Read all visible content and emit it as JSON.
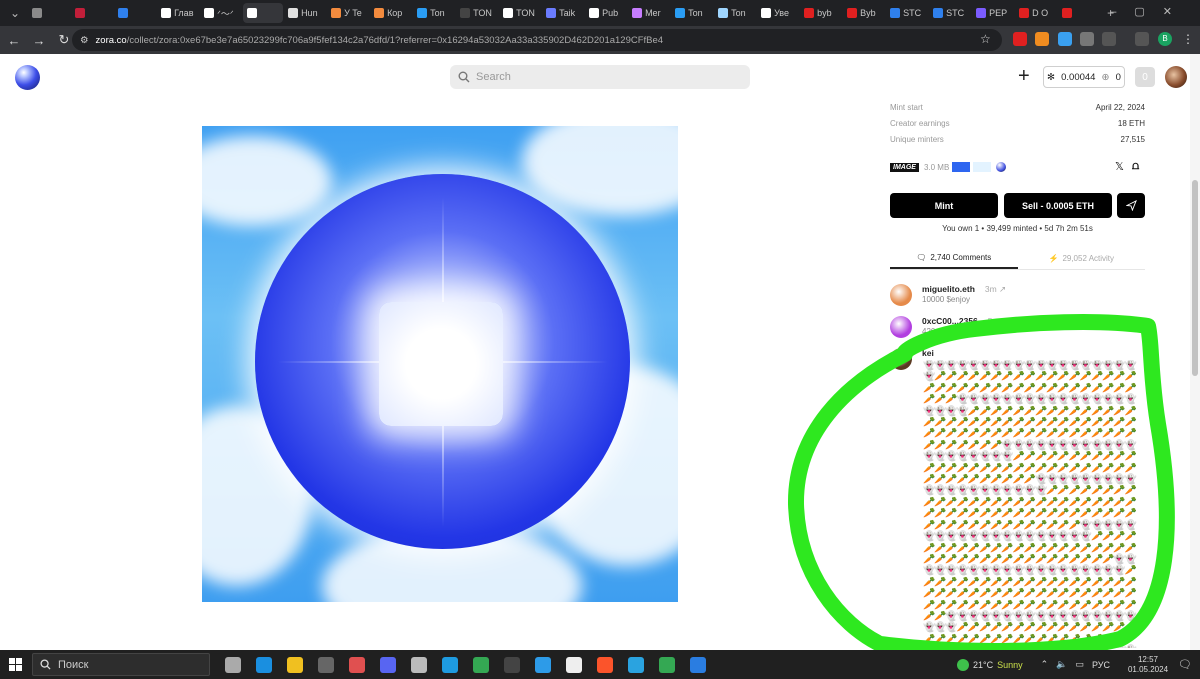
{
  "browser": {
    "tabs": [
      {
        "label": "",
        "color": "#8a8a8a"
      },
      {
        "label": "",
        "color": "#c21f3a"
      },
      {
        "label": "",
        "color": "#2f80ed"
      },
      {
        "label": "Глав",
        "color": "#ffffff"
      },
      {
        "label": "ᐟ〜ᐟ",
        "color": "#ffffff"
      },
      {
        "label": "",
        "color": "#ffffff"
      },
      {
        "label": "Hun",
        "color": "#e0e0e0"
      },
      {
        "label": "У Te",
        "color": "#f38b3e"
      },
      {
        "label": "Кор",
        "color": "#f38b3e"
      },
      {
        "label": "Ton",
        "color": "#2a9df4"
      },
      {
        "label": "TON",
        "color": "#444444"
      },
      {
        "label": "TON",
        "color": "#ffffff"
      },
      {
        "label": "Taik",
        "color": "#6b7cff"
      },
      {
        "label": "Pub",
        "color": "#ffffff"
      },
      {
        "label": "Mer",
        "color": "#c77dff"
      },
      {
        "label": "Ton",
        "color": "#2a9df4"
      },
      {
        "label": "Ton",
        "color": "#9fd6ff"
      },
      {
        "label": "Уве",
        "color": "#ffffff"
      },
      {
        "label": "byb",
        "color": "#e02020"
      },
      {
        "label": "Byb",
        "color": "#e02020"
      },
      {
        "label": "STC",
        "color": "#2f80ed"
      },
      {
        "label": "STC",
        "color": "#2f80ed"
      },
      {
        "label": "PEP",
        "color": "#7b5cff"
      },
      {
        "label": "D O",
        "color": "#e02020"
      },
      {
        "label": "",
        "color": "#e02020"
      }
    ],
    "new_tab": "+",
    "url_host": "zora.co",
    "url_path": "/collect/zora:0xe67be3e7a65023299fc706a9f5fef134c2a76dfd/1?referrer=0x16294a53032Aa33a335902D462D201a129CFfBe4",
    "profile": "B"
  },
  "header": {
    "search_placeholder": "Search",
    "balance": "0.00044",
    "points": "0",
    "notif_count": "0"
  },
  "details": {
    "mint_start_label": "Mint start",
    "mint_start_value": "April 22, 2024",
    "creator_earnings_label": "Creator earnings",
    "creator_earnings_value": "18 ETH",
    "unique_minters_label": "Unique minters",
    "unique_minters_value": "27,515",
    "media_tag": "IMAGE",
    "file_size": "3.0 MB",
    "swatch1": "#2e66f0",
    "swatch2": "#e3f3ff"
  },
  "actions": {
    "mint_label": "Mint",
    "sell_label": "Sell - 0.0005 ETH",
    "owned_text": "You own 1 • 39,499 minted • 5d 7h 2m 51s"
  },
  "comment_tabs": {
    "comments_label": "2,740 Comments",
    "activity_label": "29,052 Activity"
  },
  "comments": [
    {
      "name": "miguelito.eth",
      "time": "3m ↗",
      "text": "10000 $enjoy",
      "avatar_color": "#e58a4a"
    },
    {
      "name": "0xcC00...2356",
      "time": "5m ↗",
      "text": "420",
      "avatar_color": "#b23fe0"
    },
    {
      "name": "kei",
      "time": "",
      "text": "",
      "avatar_color": "#5b3a22"
    }
  ],
  "spam_text": "🥕🥕🥕🥕🥕🥕🥕🥕🥕🥕🥕🥕🥕🥕🥕🥕🥕🥕🥕🥕",
  "taskbar": {
    "search_label": "Поиск",
    "temperature": "21°C",
    "condition": "Sunny",
    "language": "РУС",
    "time": "12:57",
    "date": "01.05.2024"
  }
}
